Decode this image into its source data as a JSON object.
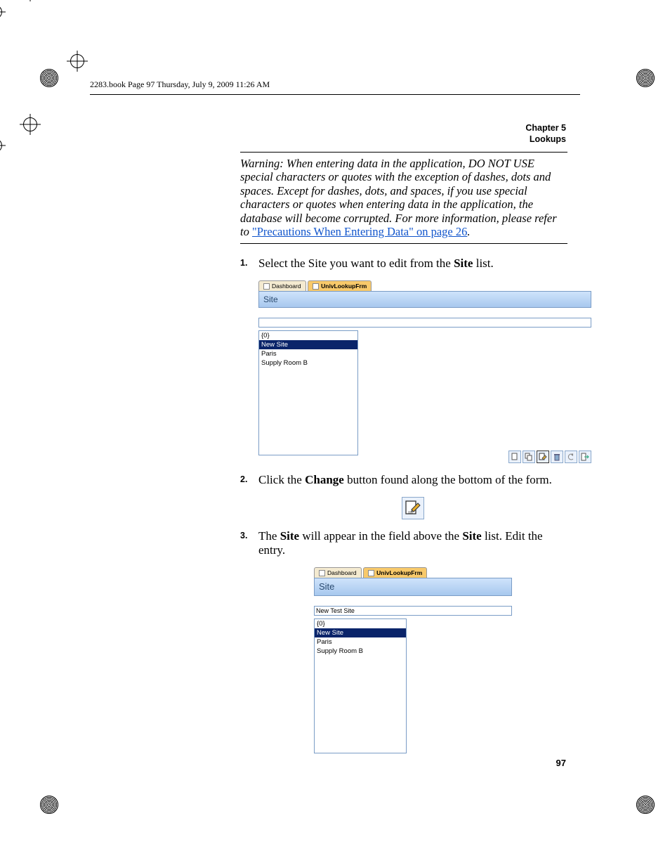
{
  "header": {
    "running_head": "2283.book  Page 97  Thursday, July 9, 2009  11:26 AM"
  },
  "chapter": {
    "line1": "Chapter 5",
    "line2": "Lookups"
  },
  "warning": {
    "prefix": "Warning:   ",
    "body": "When entering data in the application, DO NOT USE special characters or quotes with the exception of dashes, dots and spaces. Except for dashes, dots, and spaces, if you use special characters or quotes when entering data in the application, the database will become corrupted. For more information, please refer to ",
    "link_text": "\"Precautions When Entering Data\" on page 26",
    "suffix": "."
  },
  "steps": {
    "s1": {
      "num": "1.",
      "before": "Select the Site you want to edit from the ",
      "bold": "Site",
      "after": " list."
    },
    "s2": {
      "num": "2.",
      "before": "Click the ",
      "bold": "Change",
      "after": " button found along the bottom of the form."
    },
    "s3": {
      "num": "3.",
      "before1": "The ",
      "bold1": "Site",
      "mid": " will appear in the field above the ",
      "bold2": "Site",
      "after": " list. Edit the entry."
    }
  },
  "screenshot1": {
    "tabs": {
      "dashboard": "Dashboard",
      "lookup": "UnivLookupFrm"
    },
    "title": "Site",
    "input_value": "",
    "list": [
      "{0}",
      "New Site",
      "Paris",
      "Supply Room B"
    ],
    "selected_index": 1
  },
  "screenshot2": {
    "tabs": {
      "dashboard": "Dashboard",
      "lookup": "UnivLookupFrm"
    },
    "title": "Site",
    "input_value": "New Test Site",
    "list": [
      "{0}",
      "New Site",
      "Paris",
      "Supply Room B"
    ],
    "selected_index": 1
  },
  "page_number": "97"
}
